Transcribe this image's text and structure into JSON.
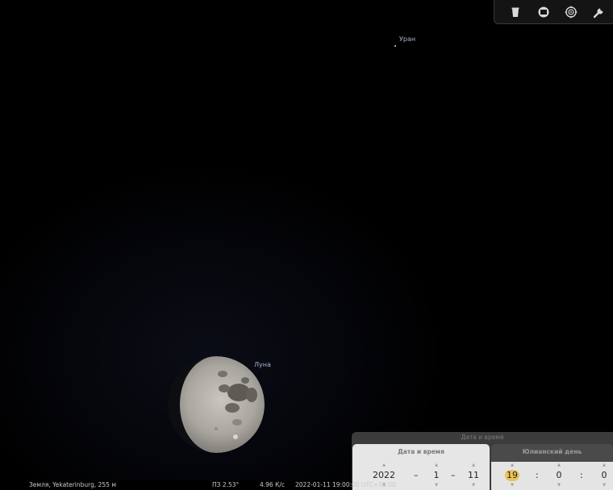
{
  "toolbar": {
    "buttons": [
      {
        "name": "trash-icon"
      },
      {
        "name": "screen-mode-icon"
      },
      {
        "name": "target-icon"
      },
      {
        "name": "wrench-icon"
      }
    ]
  },
  "sky": {
    "objects": [
      {
        "label": "Уран"
      },
      {
        "label": "Луна"
      }
    ]
  },
  "status": {
    "location": "Земля, Yekaterinburg, 255 м",
    "fov": "ПЗ 2.53°",
    "fps": "4.96 К/с",
    "datetime": "2022-01-11 19:00:00 UTC+05:00"
  },
  "datetime_dialog": {
    "title": "Дата и время",
    "tabs": [
      {
        "label": "Дата и время",
        "active": true
      },
      {
        "label": "Юлианский день",
        "active": false
      }
    ],
    "date": {
      "year": "2022",
      "month": "1",
      "day": "11",
      "separator": "–"
    },
    "time": {
      "hour": "19",
      "minute": "0",
      "second": "0",
      "separator": ":"
    },
    "arrow_up": "▲",
    "arrow_down": "▼"
  },
  "colors": {
    "sky": "#000000",
    "label": "#a9b4c8",
    "highlight": "#e8c35a",
    "panel": "#3c3c3c"
  }
}
